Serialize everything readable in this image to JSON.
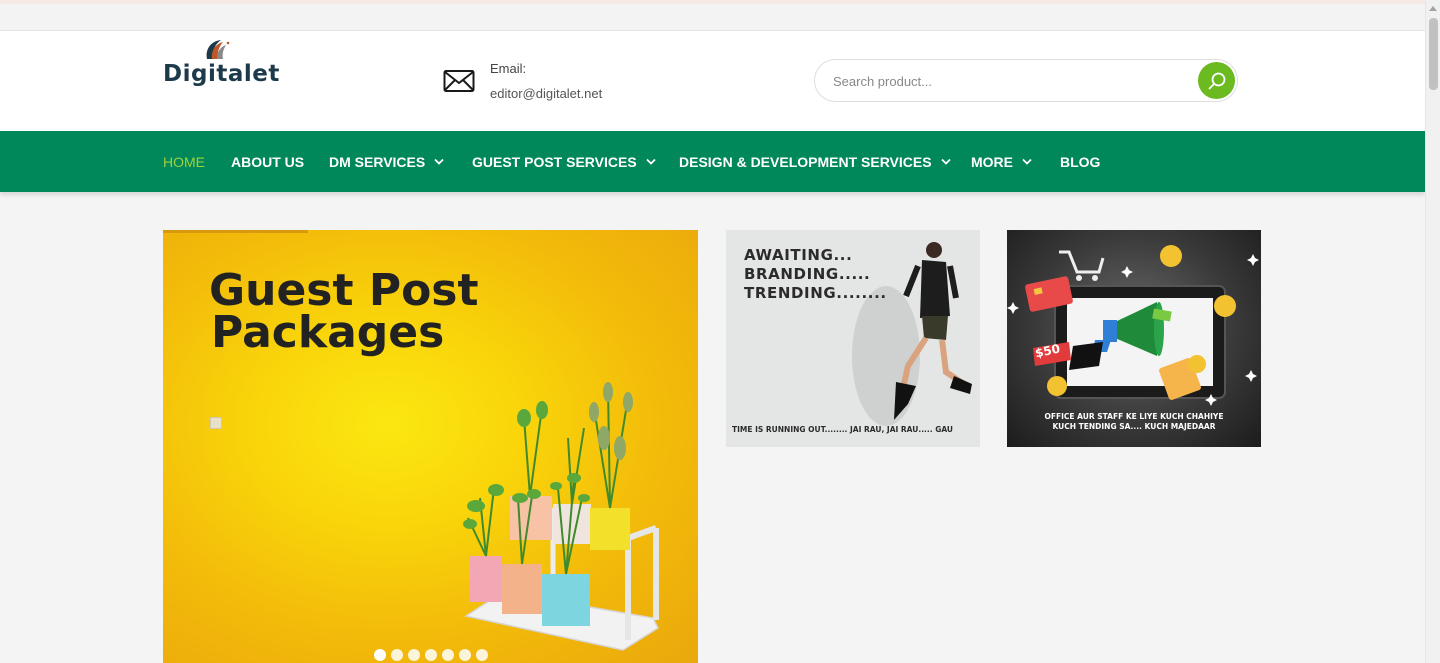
{
  "header": {
    "logo_text": "Digitalet",
    "email_label": "Email:",
    "email_value": "editor@digitalet.net",
    "search_placeholder": "Search product..."
  },
  "nav": {
    "items": [
      {
        "label": "HOME",
        "active": true
      },
      {
        "label": "ABOUT US"
      },
      {
        "label": "DM SERVICES",
        "dropdown": true
      },
      {
        "label": "GUEST POST SERVICES",
        "dropdown": true
      },
      {
        "label": "DESIGN & DEVELOPMENT SERVICES",
        "dropdown": true
      },
      {
        "label": "MORE",
        "dropdown": true
      },
      {
        "label": "BLOG"
      }
    ]
  },
  "hero": {
    "title_line1": "Guest Post",
    "title_line2": "Packages",
    "slide_count": 7,
    "active_slide": 1
  },
  "cards": {
    "card1": {
      "line1": "AWAITING...",
      "line2": "BRANDING.....",
      "line3": "TRENDING........",
      "footer": "TIME IS RUNNING OUT........ JAI RAU, JAI RAU..... GAU"
    },
    "card2": {
      "price_tag": "$50",
      "footer_line1": "OFFICE AUR STAFF KE LIYE KUCH CHAHIYE",
      "footer_line2": "KUCH TENDING SA.... KUCH MAJEDAAR"
    }
  },
  "colors": {
    "nav_bg": "#00875a",
    "nav_active": "#9fd23a",
    "search_button": "#6bba1f",
    "hero_yellow": "#f9d50a"
  },
  "icons": {
    "mail": "mail-icon",
    "search": "search-icon",
    "dropdown": "chevron-down-icon"
  }
}
